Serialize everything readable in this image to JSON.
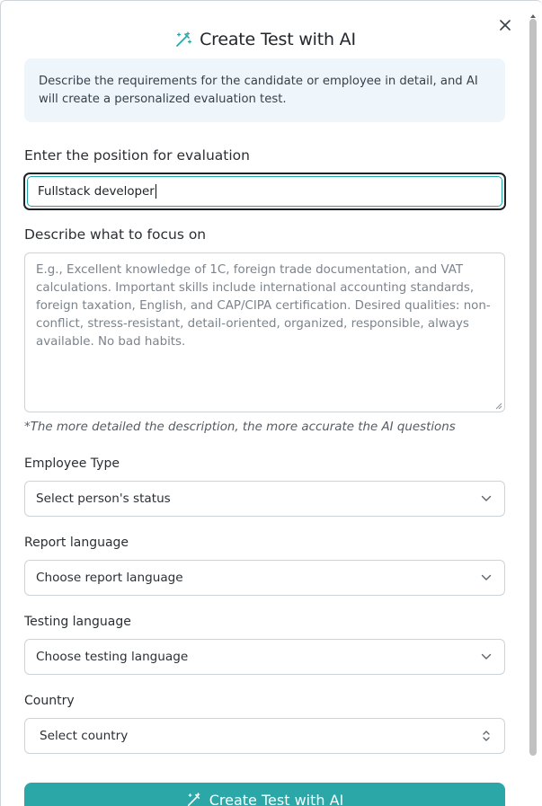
{
  "dialog": {
    "title": "Create Test with AI",
    "info": "Describe the requirements for the candidate or employee in detail, and AI will create a personalized evaluation test."
  },
  "position": {
    "label": "Enter the position for evaluation",
    "value": "Fullstack developer"
  },
  "focus": {
    "label": "Describe what to focus on",
    "placeholder": "E.g., Excellent knowledge of 1C, foreign trade documentation, and VAT calculations. Important skills include international accounting standards, foreign taxation, English, and CAP/CIPA certification. Desired qualities: non-conflict, stress-resistant, detail-oriented, organized, responsible, always available. No bad habits.",
    "hint": "*The more detailed the description, the more accurate the AI questions"
  },
  "employee_type": {
    "label": "Employee Type",
    "selected": "Select person's status"
  },
  "report_language": {
    "label": "Report language",
    "selected": "Choose report language"
  },
  "testing_language": {
    "label": "Testing language",
    "selected": "Choose testing language"
  },
  "country": {
    "label": "Country",
    "selected": "Select country"
  },
  "submit": {
    "label": "Create Test with AI"
  },
  "colors": {
    "accent": "#2aa7a6",
    "info_bg": "#eef6fc",
    "border": "#cdd3d9"
  },
  "icons": {
    "title": "magic-wand-icon",
    "close": "close-icon",
    "select": "chevron-down-icon",
    "country_select": "chevron-up-down-icon",
    "submit": "magic-wand-icon"
  }
}
